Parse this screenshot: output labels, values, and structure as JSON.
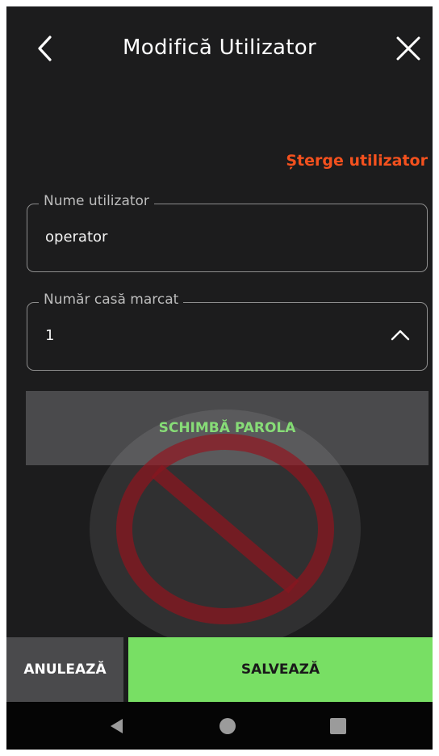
{
  "header": {
    "title": "Modifică Utilizator",
    "back_icon": "chevron-left-icon",
    "close_icon": "close-icon"
  },
  "delete_user_label": "Șterge utilizator",
  "form": {
    "username": {
      "label": "Nume utilizator",
      "value": "operator"
    },
    "register_number": {
      "label": "Număr casă marcat",
      "value": "1",
      "icon": "chevron-up-icon"
    }
  },
  "change_password_label": "SCHIMBĂ PAROLA",
  "footer": {
    "cancel_label": "ANULEAZĂ",
    "save_label": "SALVEAZĂ"
  },
  "colors": {
    "background": "#1c1c1d",
    "accent_green": "#78df64",
    "danger_orange": "#f4511e",
    "surface_gray": "#4a4a4c"
  }
}
